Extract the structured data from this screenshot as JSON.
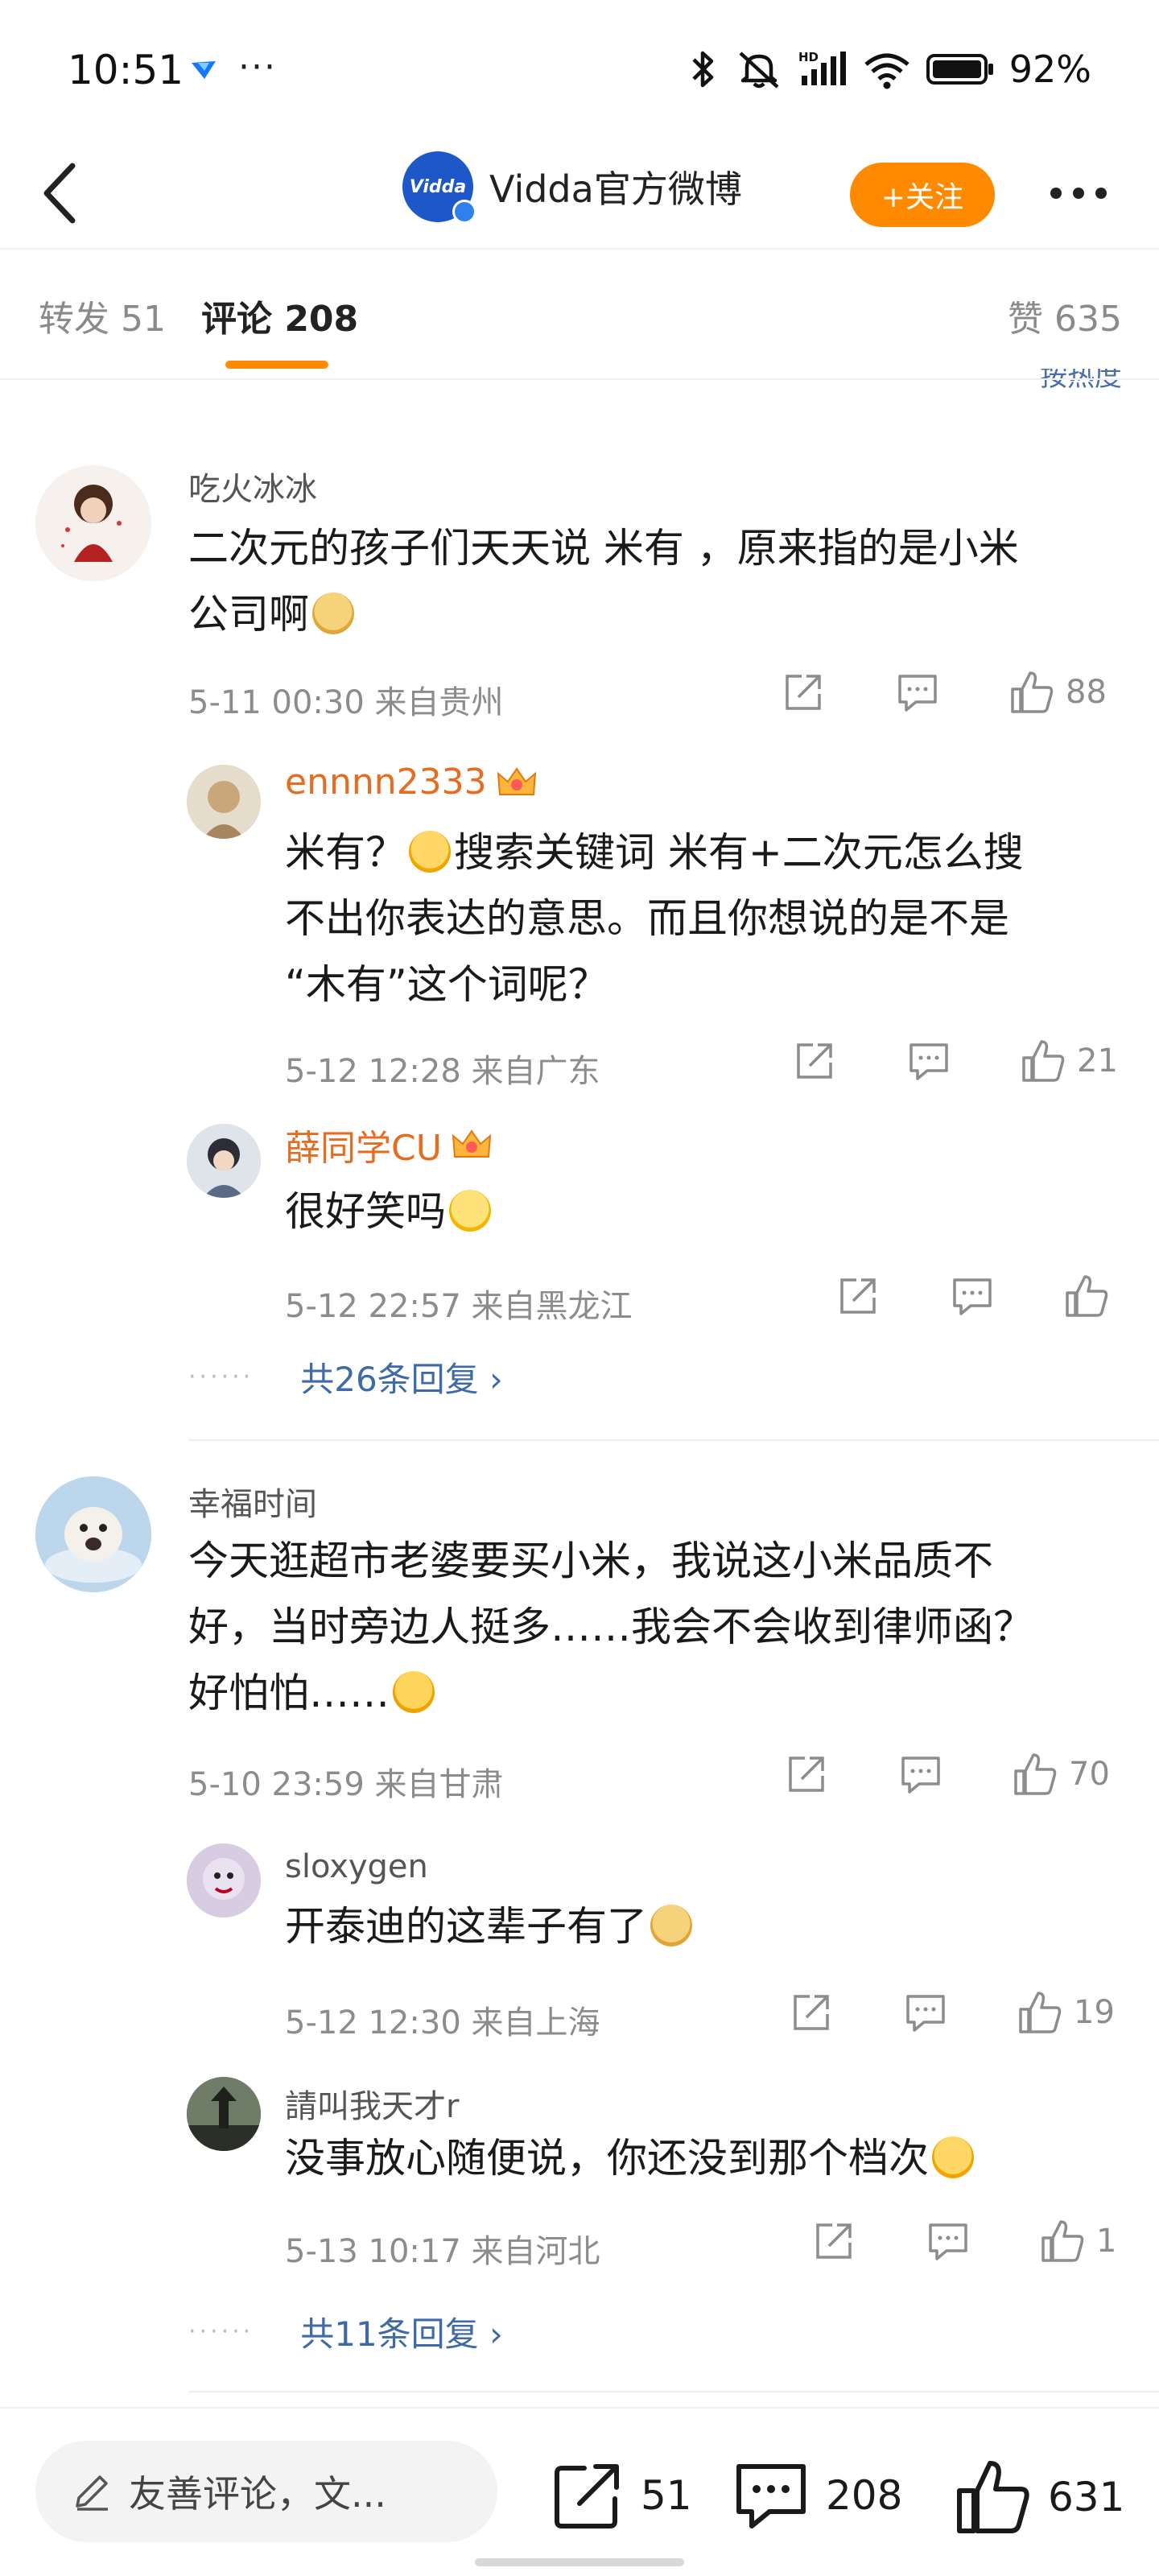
{
  "status_bar": {
    "time": "10:51",
    "dots": "···",
    "battery": "92%",
    "network": "HD"
  },
  "header": {
    "account_name": "Vidda官方微博",
    "avatar_text": "Vidda",
    "follow_label": "+关注"
  },
  "tabs": {
    "repost": "转发 51",
    "comments": "评论 208",
    "likes": "赞 635"
  },
  "sort_hint": "按热度",
  "comments": [
    {
      "name": "吃火冰冰",
      "text_line1": "二次元的孩子们天天说 米有 ，原来指的是小米",
      "text_line2": "公司啊",
      "meta": "5-11 00:30  来自贵州",
      "likes": "88",
      "replies": [
        {
          "name": "ennnn2333",
          "text_line1a": "米有？",
          "text_line1b": "搜索关键词 米有+二次元怎么搜",
          "text_line2": "不出你表达的意思。而且你想说的是不是",
          "text_line3": "“木有”这个词呢？",
          "meta": "5-12 12:28  来自广东",
          "likes": "21"
        },
        {
          "name": "薛同学CU",
          "text": "很好笑吗",
          "meta": "5-12 22:57  来自黑龙江",
          "likes": ""
        }
      ],
      "more_replies": "共26条回复 ›"
    },
    {
      "name": "幸福时间",
      "text_line1": "今天逛超市老婆要买小米，我说这小米品质不",
      "text_line2": "好，当时旁边人挺多……我会不会收到律师函？",
      "text_line3": "好怕怕……",
      "meta": "5-10 23:59  来自甘肃",
      "likes": "70",
      "replies": [
        {
          "name": "sloxygen",
          "text": "开泰迪的这辈子有了",
          "meta": "5-12 12:30  来自上海",
          "likes": "19"
        },
        {
          "name": "請叫我天才r",
          "text": "没事放心随便说，你还没到那个档次",
          "meta": "5-13 10:17  来自河北",
          "likes": "1"
        }
      ],
      "more_replies": "共11条回复 ›"
    }
  ],
  "bottom_bar": {
    "input_placeholder": "友善评论，文...",
    "reposts": "51",
    "comments": "208",
    "likes": "631"
  },
  "colors": {
    "accent": "#ff8a00",
    "link": "#3f6aa8",
    "vip_name": "#e86c1f"
  }
}
